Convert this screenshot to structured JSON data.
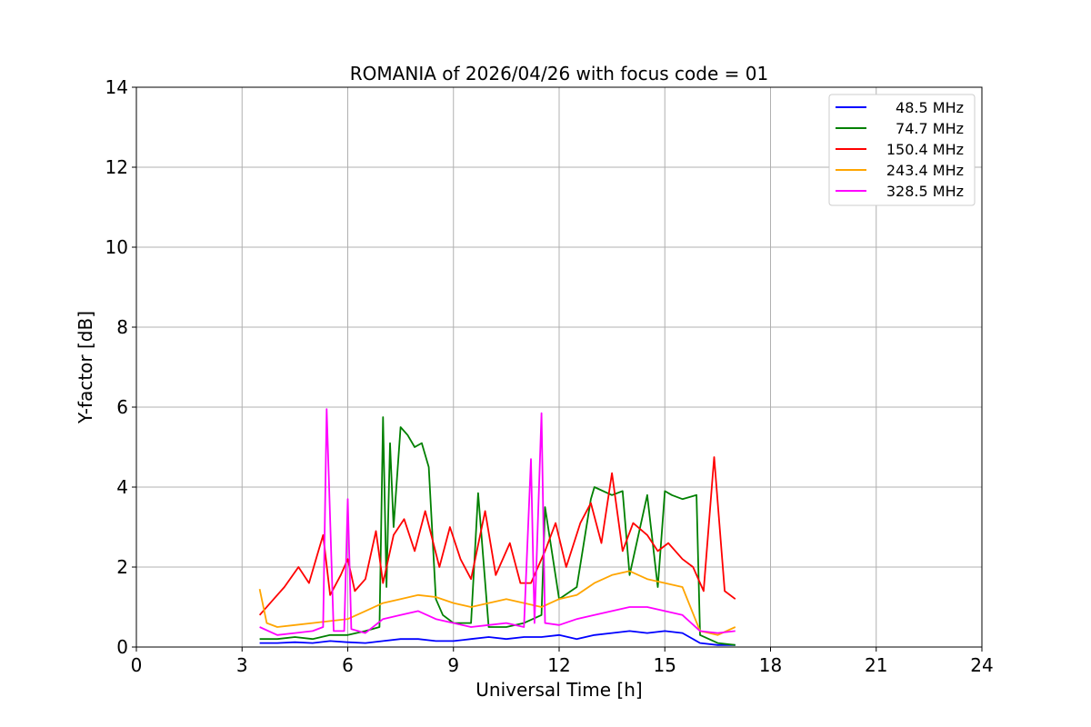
{
  "chart_data": {
    "type": "line",
    "title": "ROMANIA of 2026/04/26 with focus code = 01",
    "xlabel": "Universal Time [h]",
    "ylabel": "Y-factor [dB]",
    "xlim": [
      0,
      24
    ],
    "ylim": [
      0,
      14
    ],
    "xticks": [
      0,
      3,
      6,
      9,
      12,
      15,
      18,
      21,
      24
    ],
    "yticks": [
      0,
      2,
      4,
      6,
      8,
      10,
      12,
      14
    ],
    "xtick_labels": [
      "0",
      "3",
      "6",
      "9",
      "12",
      "15",
      "18",
      "21",
      "24"
    ],
    "ytick_labels": [
      "0",
      "2",
      "4",
      "6",
      "8",
      "10",
      "12",
      "14"
    ],
    "grid": true,
    "legend_position": "top-right",
    "series": [
      {
        "name": "48.5 MHz",
        "color": "#0000ff",
        "x": [
          3.5,
          4.0,
          4.5,
          5.0,
          5.5,
          6.0,
          6.5,
          7.0,
          7.5,
          8.0,
          8.5,
          9.0,
          9.5,
          10.0,
          10.5,
          11.0,
          11.5,
          12.0,
          12.5,
          13.0,
          13.5,
          14.0,
          14.5,
          15.0,
          15.5,
          16.0,
          16.5,
          17.0
        ],
        "y": [
          0.1,
          0.1,
          0.12,
          0.1,
          0.15,
          0.12,
          0.1,
          0.15,
          0.2,
          0.2,
          0.15,
          0.15,
          0.2,
          0.25,
          0.2,
          0.25,
          0.25,
          0.3,
          0.2,
          0.3,
          0.35,
          0.4,
          0.35,
          0.4,
          0.35,
          0.1,
          0.05,
          0.05
        ]
      },
      {
        "name": "74.7 MHz",
        "color": "#008000",
        "x": [
          3.5,
          4.0,
          4.5,
          5.0,
          5.5,
          6.0,
          6.5,
          6.9,
          7.0,
          7.1,
          7.2,
          7.3,
          7.5,
          7.7,
          7.9,
          8.1,
          8.3,
          8.5,
          8.7,
          9.0,
          9.5,
          9.7,
          10.0,
          10.5,
          11.0,
          11.5,
          11.6,
          12.0,
          12.5,
          12.9,
          13.0,
          13.5,
          13.8,
          14.0,
          14.5,
          14.8,
          15.0,
          15.2,
          15.5,
          15.9,
          16.0,
          16.5,
          17.0
        ],
        "y": [
          0.2,
          0.2,
          0.25,
          0.2,
          0.3,
          0.3,
          0.4,
          0.5,
          5.75,
          1.5,
          5.1,
          3.0,
          5.5,
          5.3,
          5.0,
          5.1,
          4.5,
          1.2,
          0.8,
          0.6,
          0.6,
          3.85,
          0.5,
          0.5,
          0.6,
          0.8,
          3.5,
          1.2,
          1.5,
          3.7,
          4.0,
          3.8,
          3.9,
          1.8,
          3.8,
          1.5,
          3.9,
          3.8,
          3.7,
          3.8,
          0.3,
          0.1,
          0.05
        ]
      },
      {
        "name": "150.4 MHz",
        "color": "#ff0000",
        "x": [
          3.5,
          3.9,
          4.2,
          4.6,
          4.9,
          5.1,
          5.3,
          5.5,
          5.8,
          6.0,
          6.2,
          6.5,
          6.8,
          7.0,
          7.3,
          7.6,
          7.9,
          8.2,
          8.6,
          8.9,
          9.2,
          9.5,
          9.9,
          10.2,
          10.6,
          10.9,
          11.2,
          11.6,
          11.9,
          12.2,
          12.6,
          12.9,
          13.2,
          13.5,
          13.8,
          14.1,
          14.5,
          14.8,
          15.1,
          15.5,
          15.8,
          16.1,
          16.4,
          16.7,
          17.0
        ],
        "y": [
          0.8,
          1.2,
          1.5,
          2.0,
          1.6,
          2.2,
          2.8,
          1.3,
          1.8,
          2.2,
          1.4,
          1.7,
          2.9,
          1.6,
          2.8,
          3.2,
          2.4,
          3.4,
          2.0,
          3.0,
          2.2,
          1.7,
          3.4,
          1.8,
          2.6,
          1.6,
          1.6,
          2.4,
          3.1,
          2.0,
          3.1,
          3.6,
          2.6,
          4.35,
          2.4,
          3.1,
          2.8,
          2.4,
          2.6,
          2.2,
          2.0,
          1.4,
          4.75,
          1.4,
          1.2
        ]
      },
      {
        "name": "243.4 MHz",
        "color": "#ffa500",
        "x": [
          3.5,
          3.7,
          4.0,
          4.5,
          5.0,
          5.5,
          6.0,
          6.5,
          7.0,
          7.5,
          8.0,
          8.5,
          9.0,
          9.5,
          10.0,
          10.5,
          11.0,
          11.5,
          12.0,
          12.5,
          13.0,
          13.5,
          14.0,
          14.5,
          15.0,
          15.5,
          16.0,
          16.5,
          17.0
        ],
        "y": [
          1.45,
          0.6,
          0.5,
          0.55,
          0.6,
          0.65,
          0.7,
          0.9,
          1.1,
          1.2,
          1.3,
          1.25,
          1.1,
          1.0,
          1.1,
          1.2,
          1.1,
          1.0,
          1.2,
          1.3,
          1.6,
          1.8,
          1.9,
          1.7,
          1.6,
          1.5,
          0.4,
          0.3,
          0.5
        ]
      },
      {
        "name": "328.5 MHz",
        "color": "#ff00ff",
        "x": [
          3.5,
          4.0,
          4.5,
          5.0,
          5.3,
          5.4,
          5.6,
          5.9,
          6.0,
          6.1,
          6.5,
          7.0,
          7.5,
          8.0,
          8.5,
          9.0,
          9.5,
          10.0,
          10.5,
          11.0,
          11.2,
          11.3,
          11.5,
          11.6,
          12.0,
          12.5,
          13.0,
          13.5,
          14.0,
          14.5,
          15.0,
          15.5,
          16.0,
          16.5,
          17.0
        ],
        "y": [
          0.5,
          0.3,
          0.35,
          0.4,
          0.5,
          5.95,
          0.4,
          0.4,
          3.7,
          0.45,
          0.35,
          0.7,
          0.8,
          0.9,
          0.7,
          0.6,
          0.5,
          0.55,
          0.6,
          0.5,
          4.7,
          0.6,
          5.85,
          0.6,
          0.55,
          0.7,
          0.8,
          0.9,
          1.0,
          1.0,
          0.9,
          0.8,
          0.4,
          0.35,
          0.4
        ]
      }
    ]
  }
}
